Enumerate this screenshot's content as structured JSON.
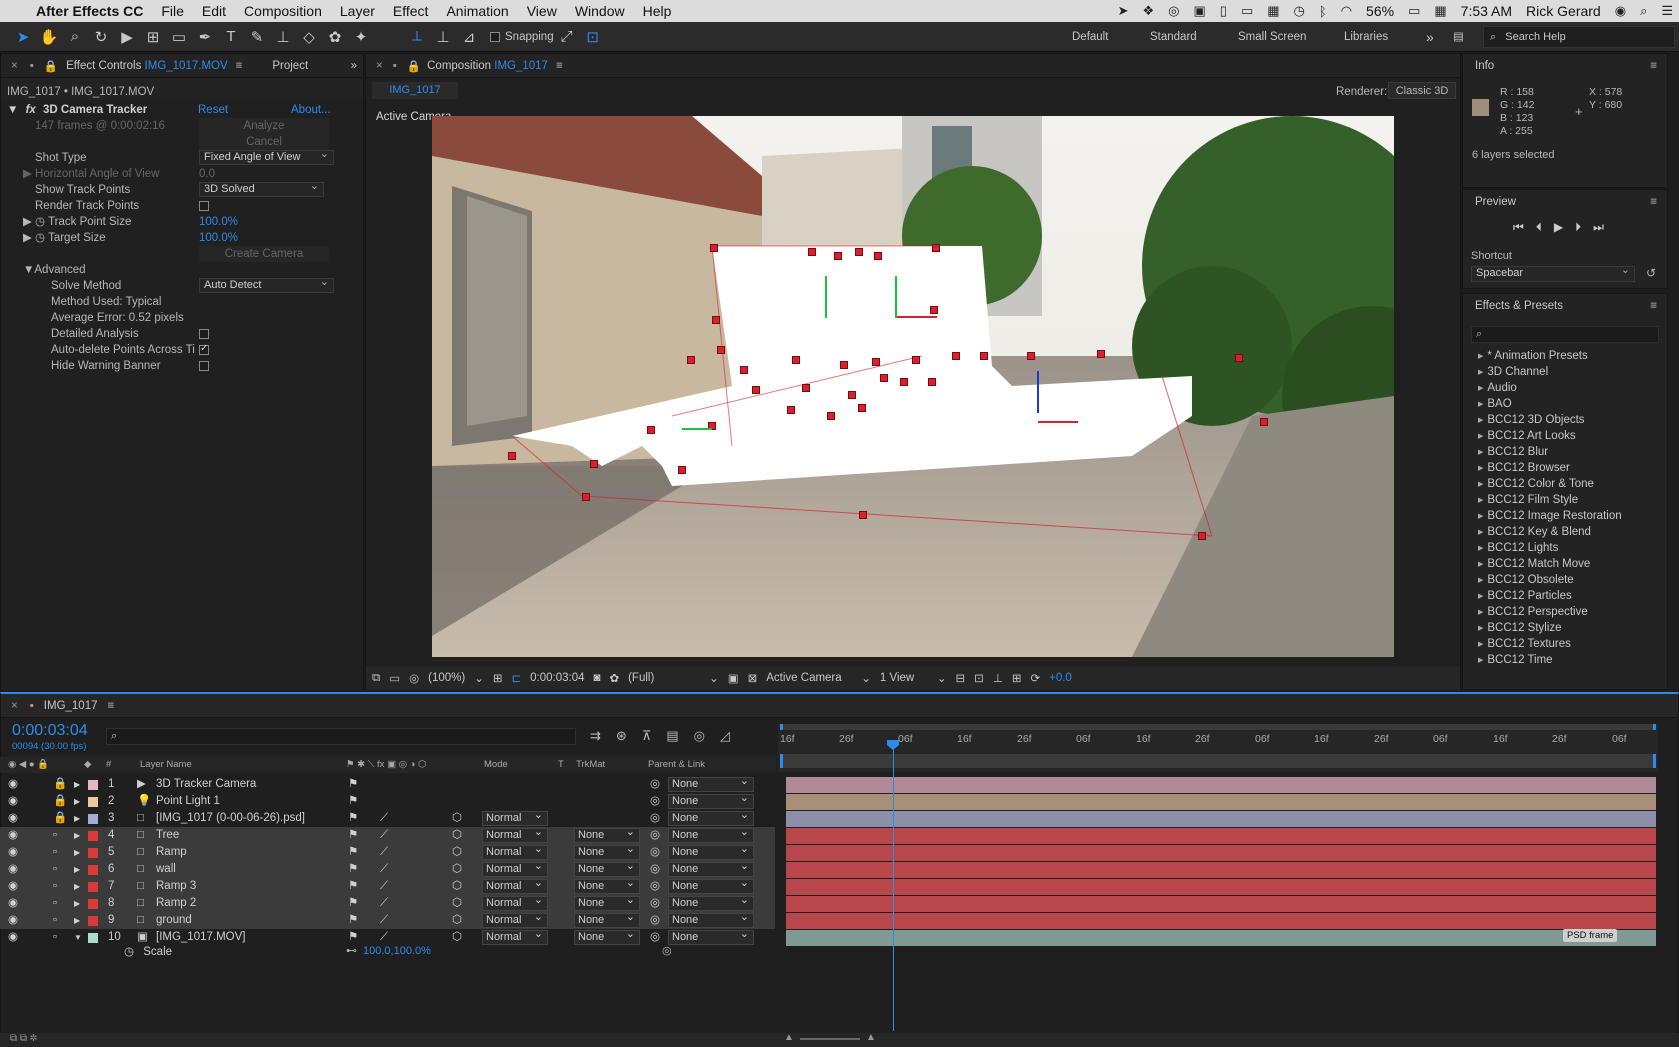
{
  "menubar": {
    "app": "After Effects CC",
    "items": [
      "File",
      "Edit",
      "Composition",
      "Layer",
      "Effect",
      "Animation",
      "View",
      "Window",
      "Help"
    ],
    "battery": "56%",
    "time": "7:53 AM",
    "user": "Rick Gerard"
  },
  "toolbar": {
    "snapping": "Snapping",
    "workspaces": [
      "Default",
      "Standard",
      "Small Screen",
      "Libraries"
    ],
    "search_placeholder": "Search Help"
  },
  "effect_controls": {
    "tab_prefix": "Effect Controls",
    "tab_file": "IMG_1017.MOV",
    "project_tab": "Project",
    "breadcrumb": "IMG_1017 • IMG_1017.MOV",
    "effect_name": "3D Camera Tracker",
    "reset": "Reset",
    "about": "About...",
    "frames": "147 frames @ 0:00:02:16",
    "analyze": "Analyze",
    "cancel": "Cancel",
    "shot_type_label": "Shot Type",
    "shot_type_value": "Fixed Angle of View",
    "hangle_label": "Horizontal Angle of View",
    "hangle_value": "0.0",
    "show_track_label": "Show Track Points",
    "show_track_value": "3D Solved",
    "render_track_label": "Render Track Points",
    "track_size_label": "Track Point Size",
    "track_size_value": "100.0%",
    "target_size_label": "Target Size",
    "target_size_value": "100.0%",
    "create_camera": "Create Camera",
    "advanced": "Advanced",
    "solve_method_label": "Solve Method",
    "solve_method_value": "Auto Detect",
    "method_used": "Method Used: Typical",
    "avg_error": "Average Error: 0.52 pixels",
    "detailed": "Detailed Analysis",
    "autodelete": "Auto-delete Points Across Ti",
    "hide_warning": "Hide Warning Banner"
  },
  "composition": {
    "tab_prefix": "Composition",
    "tab_name": "IMG_1017",
    "subtab": "IMG_1017",
    "renderer_label": "Renderer:",
    "renderer_value": "Classic 3D",
    "view_label": "Active Camera",
    "zoom": "(100%)",
    "timecode": "0:00:03:04",
    "resolution": "(Full)",
    "camera": "Active Camera",
    "views": "1 View",
    "exposure": "+0.0"
  },
  "info": {
    "title": "Info",
    "r": "R :  158",
    "g": "G :  142",
    "b": "B :  123",
    "a": "A :  255",
    "x": "X : 578",
    "y": "Y : 680",
    "selected": "6 layers selected",
    "color": "#9e8e7b"
  },
  "preview": {
    "title": "Preview",
    "shortcut_label": "Shortcut",
    "shortcut_value": "Spacebar"
  },
  "presets": {
    "title": "Effects & Presets",
    "items": [
      "* Animation Presets",
      "3D Channel",
      "Audio",
      "BAO",
      "BCC12 3D Objects",
      "BCC12 Art Looks",
      "BCC12 Blur",
      "BCC12 Browser",
      "BCC12 Color & Tone",
      "BCC12 Film Style",
      "BCC12 Image Restoration",
      "BCC12 Key & Blend",
      "BCC12 Lights",
      "BCC12 Match Move",
      "BCC12 Obsolete",
      "BCC12 Particles",
      "BCC12 Perspective",
      "BCC12 Stylize",
      "BCC12 Textures",
      "BCC12 Time"
    ]
  },
  "timeline": {
    "tab": "IMG_1017",
    "timecode": "0:00:03:04",
    "frames": "00094 (30.00 fps)",
    "col_num": "#",
    "col_name": "Layer Name",
    "col_mode": "Mode",
    "col_t": "T",
    "col_trkmat": "TrkMat",
    "col_parent": "Parent & Link",
    "ruler": [
      "16f",
      "26f",
      "06f",
      "16f",
      "26f",
      "06f",
      "16f",
      "26f",
      "06f",
      "16f",
      "26f",
      "06f",
      "16f",
      "26f",
      "06f"
    ],
    "layers": [
      {
        "num": "1",
        "name": "3D Tracker Camera",
        "color": "#e7b6c4",
        "mode": "",
        "trkmat": "",
        "parent": "None",
        "bar": "#b08a96",
        "sel": false
      },
      {
        "num": "2",
        "name": "Point Light 1",
        "color": "#e8c9a0",
        "mode": "",
        "trkmat": "",
        "parent": "None",
        "bar": "#a88f78",
        "sel": false
      },
      {
        "num": "3",
        "name": "[IMG_1017 (0-00-06-26).psd]",
        "color": "#a9a9d8",
        "mode": "Normal",
        "trkmat": "",
        "parent": "None",
        "bar": "#8d8ea8",
        "sel": false
      },
      {
        "num": "4",
        "name": "Tree",
        "color": "#d93b3b",
        "mode": "Normal",
        "trkmat": "None",
        "parent": "None",
        "bar": "#b8474b",
        "sel": true
      },
      {
        "num": "5",
        "name": "Ramp",
        "color": "#d93b3b",
        "mode": "Normal",
        "trkmat": "None",
        "parent": "None",
        "bar": "#b8474b",
        "sel": true
      },
      {
        "num": "6",
        "name": "wall",
        "color": "#d93b3b",
        "mode": "Normal",
        "trkmat": "None",
        "parent": "None",
        "bar": "#b8474b",
        "sel": true
      },
      {
        "num": "7",
        "name": "Ramp 3",
        "color": "#d93b3b",
        "mode": "Normal",
        "trkmat": "None",
        "parent": "None",
        "bar": "#b8474b",
        "sel": true
      },
      {
        "num": "8",
        "name": "Ramp 2",
        "color": "#d93b3b",
        "mode": "Normal",
        "trkmat": "None",
        "parent": "None",
        "bar": "#b8474b",
        "sel": true
      },
      {
        "num": "9",
        "name": "ground",
        "color": "#d93b3b",
        "mode": "Normal",
        "trkmat": "None",
        "parent": "None",
        "bar": "#b8474b",
        "sel": true
      },
      {
        "num": "10",
        "name": "[IMG_1017.MOV]",
        "color": "#a8dcd0",
        "mode": "Normal",
        "trkmat": "None",
        "parent": "None",
        "bar": "#7f9a94",
        "sel": false
      }
    ],
    "scale_label": "Scale",
    "scale_value": "100.0,100.0%",
    "marker": "PSD frame"
  }
}
